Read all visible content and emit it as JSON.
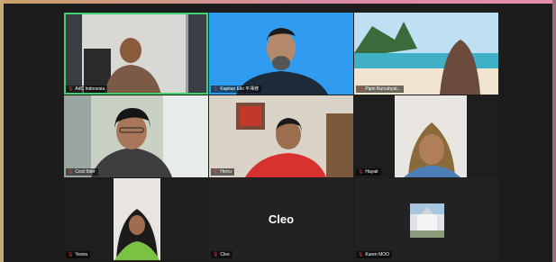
{
  "meeting": {
    "participants": [
      {
        "name": "AdC Indonesia",
        "muted": true,
        "active_speaker": true
      },
      {
        "name": "Kapitan Eiki 平澤修",
        "muted": true,
        "active_speaker": false
      },
      {
        "name": "Pipin Nurcahyat...",
        "muted": true,
        "active_speaker": false
      },
      {
        "name": "Cecil Ilder",
        "muted": true,
        "active_speaker": false
      },
      {
        "name": "Herru",
        "muted": true,
        "active_speaker": false
      },
      {
        "name": "Hayati",
        "muted": true,
        "active_speaker": false
      },
      {
        "name": "Yesna",
        "muted": true,
        "active_speaker": false
      },
      {
        "name": "Cleo",
        "muted": true,
        "active_speaker": false,
        "display_text": "Cleo"
      },
      {
        "name": "Karen MOO",
        "muted": true,
        "active_speaker": false
      }
    ]
  },
  "colors": {
    "background": "#1c1c1c",
    "active_speaker_border": "#3fd16d",
    "muted_icon": "#e0403a",
    "frame_accent": "#e88cb0"
  },
  "icons": {
    "muted": "microphone-muted-icon"
  }
}
